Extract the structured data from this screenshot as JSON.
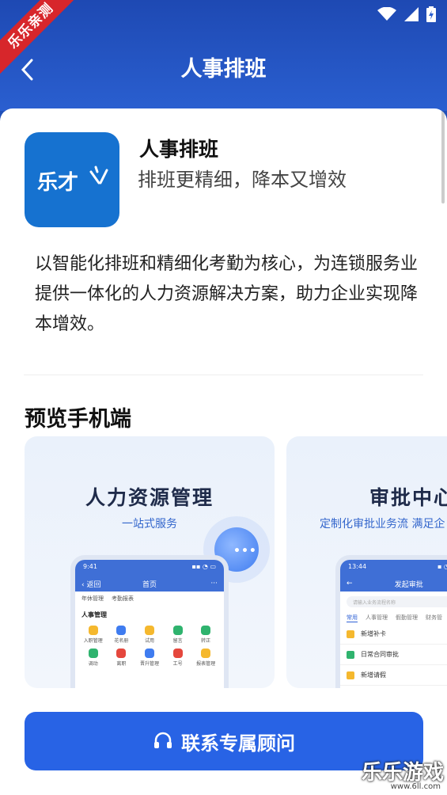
{
  "ribbon": "乐乐亲测",
  "nav": {
    "title": "人事排班"
  },
  "app": {
    "name": "人事排班",
    "slogan": "排班更精细，降本又增效",
    "logo_text": "乐才",
    "description": "以智能化排班和精细化考勤为核心，为连锁服务业提供一体化的人力资源解决方案，助力企业实现降本增效。"
  },
  "preview": {
    "title": "预览手机端",
    "cards": [
      {
        "title": "人力资源管理",
        "subtitle": "一站式服务",
        "phone": {
          "time": "9:41",
          "back": "返回",
          "title": "首页",
          "top_items": [
            "年休管理",
            "考勤报表"
          ],
          "section": "人事管理",
          "grid": [
            "入职管理",
            "花名册",
            "试用",
            "留言",
            "转正",
            "调动",
            "离职",
            "晋升管理",
            "工号",
            "报表管理"
          ]
        }
      },
      {
        "title": "审批中心",
        "subtitle": "定制化审批业务流  满足企",
        "phone": {
          "time": "13:44",
          "title": "发起审批",
          "search_placeholder": "请输入业务流程名称",
          "tabs": [
            "常用",
            "人事管理",
            "假勤管理",
            "财务管"
          ],
          "items": [
            "新增补卡",
            "日常合同审批",
            "新增请假"
          ]
        }
      }
    ]
  },
  "cta": {
    "label": "联系专属顾问"
  },
  "watermark": {
    "text": "乐乐游戏",
    "url": "www.6ll.com"
  },
  "colors": {
    "primary": "#2863e5",
    "header": "#1e49b3",
    "ribbon": "#d7262b"
  }
}
